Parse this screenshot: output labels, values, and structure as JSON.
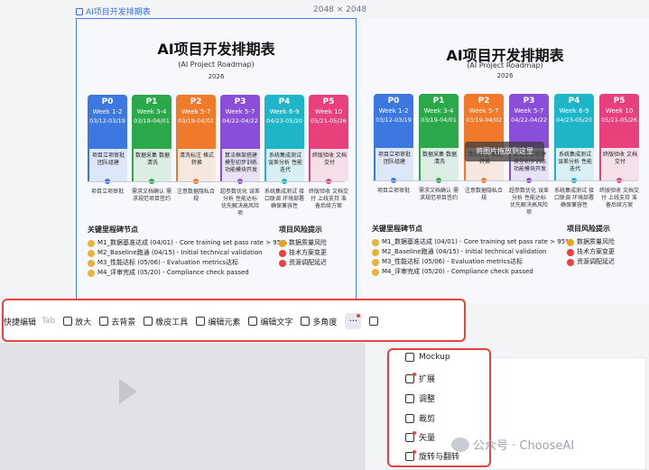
{
  "canvas": {
    "label": "AI项目开发排期表",
    "size": "2048 × 2048"
  },
  "roadmap": {
    "title": "AI项目开发排期表",
    "subtitle": "(AI Project Roadmap)",
    "year": "2026",
    "phases": [
      {
        "p": "P0",
        "week": "Week 1-2",
        "dates": "03/12-03/19",
        "color": "#3c78e0",
        "items": "项目立项审批 团队组建",
        "tasks": "项目立项审批"
      },
      {
        "p": "P1",
        "week": "Week 3-4",
        "dates": "03/19-04/01",
        "color": "#2aa84a",
        "items": "数据采集 数据清洗",
        "tasks": "需求文档确认 需求规范项目签约"
      },
      {
        "p": "P2",
        "week": "Week 5-7",
        "dates": "03/19-04/02",
        "color": "#f07a2a",
        "items": "清洗标注 格式转换",
        "tasks": "注意数据隐私合规"
      },
      {
        "p": "P3",
        "week": "Week 5-7",
        "dates": "04/22-04/22",
        "color": "#8a4fd8",
        "items": "算法框架搭建 模型初步训练 功能模块开发",
        "tasks": "超参数优化 误差分析 性能达标 优先解决高风险项"
      },
      {
        "p": "P4",
        "week": "Week 6-9",
        "dates": "04/23-05/20",
        "color": "#1fb5c8",
        "items": "系统集成测试 误差分析 性能迭代",
        "tasks": "系统集成测试 接口联调 环境部署 确保兼容性"
      },
      {
        "p": "P5",
        "week": "Week 10",
        "dates": "05/21-05/26",
        "color": "#e8407a",
        "items": "终版验收 文档交付",
        "tasks": "终版验收 文档交付 上线支持 准备后续方案"
      }
    ],
    "milestones_title": "关键里程碑节点",
    "milestones": [
      "M1_数据基准达成 (04/01) - Core training set pass rate > 95%",
      "M2_Baseline跑通 (04/15) - Initial technical validation",
      "M3_性能达标 (05/06) - Evaluation metrics达标",
      "M4_评审完成 (05/20) - Compliance check passed"
    ],
    "risks_title": "项目风险提示",
    "risks": [
      "数据质量风险",
      "技术方案变更",
      "资源调配延迟"
    ],
    "risk_colors": [
      "#e8a020",
      "#e94040",
      "#e94040"
    ]
  },
  "drop_hint": "将图片拖放到这里",
  "toolbar": {
    "quick_edit": "快捷编辑",
    "quick_edit_hint": "Tab",
    "zoom": "放大",
    "remove_bg": "去背景",
    "eraser": "橡皮工具",
    "edit_elements": "编辑元素",
    "edit_text": "编辑文字",
    "multi_angle": "多角度",
    "more": "···"
  },
  "menu": {
    "items": [
      "Mockup",
      "扩展",
      "调整",
      "裁剪",
      "矢量",
      "旋转与翻转"
    ]
  },
  "watermark": "公众号 · ChooseAI"
}
